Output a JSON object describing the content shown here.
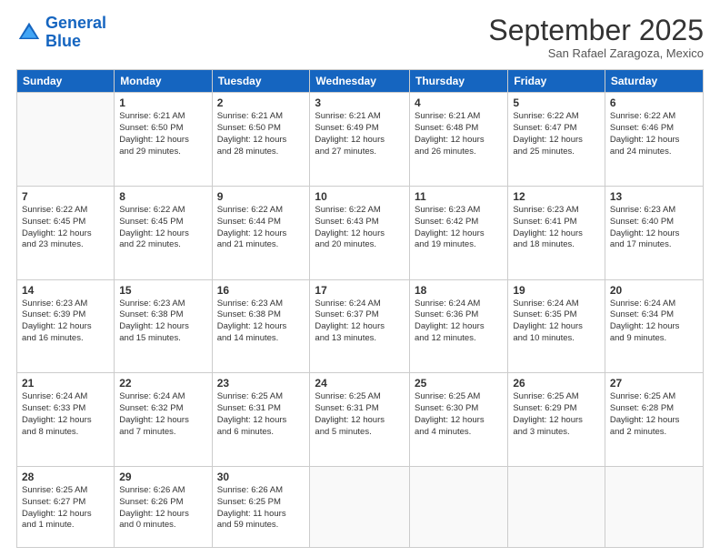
{
  "header": {
    "logo_line1": "General",
    "logo_line2": "Blue",
    "month": "September 2025",
    "location": "San Rafael Zaragoza, Mexico"
  },
  "days_of_week": [
    "Sunday",
    "Monday",
    "Tuesday",
    "Wednesday",
    "Thursday",
    "Friday",
    "Saturday"
  ],
  "weeks": [
    [
      {
        "num": "",
        "info": ""
      },
      {
        "num": "1",
        "info": "Sunrise: 6:21 AM\nSunset: 6:50 PM\nDaylight: 12 hours\nand 29 minutes."
      },
      {
        "num": "2",
        "info": "Sunrise: 6:21 AM\nSunset: 6:50 PM\nDaylight: 12 hours\nand 28 minutes."
      },
      {
        "num": "3",
        "info": "Sunrise: 6:21 AM\nSunset: 6:49 PM\nDaylight: 12 hours\nand 27 minutes."
      },
      {
        "num": "4",
        "info": "Sunrise: 6:21 AM\nSunset: 6:48 PM\nDaylight: 12 hours\nand 26 minutes."
      },
      {
        "num": "5",
        "info": "Sunrise: 6:22 AM\nSunset: 6:47 PM\nDaylight: 12 hours\nand 25 minutes."
      },
      {
        "num": "6",
        "info": "Sunrise: 6:22 AM\nSunset: 6:46 PM\nDaylight: 12 hours\nand 24 minutes."
      }
    ],
    [
      {
        "num": "7",
        "info": "Sunrise: 6:22 AM\nSunset: 6:45 PM\nDaylight: 12 hours\nand 23 minutes."
      },
      {
        "num": "8",
        "info": "Sunrise: 6:22 AM\nSunset: 6:45 PM\nDaylight: 12 hours\nand 22 minutes."
      },
      {
        "num": "9",
        "info": "Sunrise: 6:22 AM\nSunset: 6:44 PM\nDaylight: 12 hours\nand 21 minutes."
      },
      {
        "num": "10",
        "info": "Sunrise: 6:22 AM\nSunset: 6:43 PM\nDaylight: 12 hours\nand 20 minutes."
      },
      {
        "num": "11",
        "info": "Sunrise: 6:23 AM\nSunset: 6:42 PM\nDaylight: 12 hours\nand 19 minutes."
      },
      {
        "num": "12",
        "info": "Sunrise: 6:23 AM\nSunset: 6:41 PM\nDaylight: 12 hours\nand 18 minutes."
      },
      {
        "num": "13",
        "info": "Sunrise: 6:23 AM\nSunset: 6:40 PM\nDaylight: 12 hours\nand 17 minutes."
      }
    ],
    [
      {
        "num": "14",
        "info": "Sunrise: 6:23 AM\nSunset: 6:39 PM\nDaylight: 12 hours\nand 16 minutes."
      },
      {
        "num": "15",
        "info": "Sunrise: 6:23 AM\nSunset: 6:38 PM\nDaylight: 12 hours\nand 15 minutes."
      },
      {
        "num": "16",
        "info": "Sunrise: 6:23 AM\nSunset: 6:38 PM\nDaylight: 12 hours\nand 14 minutes."
      },
      {
        "num": "17",
        "info": "Sunrise: 6:24 AM\nSunset: 6:37 PM\nDaylight: 12 hours\nand 13 minutes."
      },
      {
        "num": "18",
        "info": "Sunrise: 6:24 AM\nSunset: 6:36 PM\nDaylight: 12 hours\nand 12 minutes."
      },
      {
        "num": "19",
        "info": "Sunrise: 6:24 AM\nSunset: 6:35 PM\nDaylight: 12 hours\nand 10 minutes."
      },
      {
        "num": "20",
        "info": "Sunrise: 6:24 AM\nSunset: 6:34 PM\nDaylight: 12 hours\nand 9 minutes."
      }
    ],
    [
      {
        "num": "21",
        "info": "Sunrise: 6:24 AM\nSunset: 6:33 PM\nDaylight: 12 hours\nand 8 minutes."
      },
      {
        "num": "22",
        "info": "Sunrise: 6:24 AM\nSunset: 6:32 PM\nDaylight: 12 hours\nand 7 minutes."
      },
      {
        "num": "23",
        "info": "Sunrise: 6:25 AM\nSunset: 6:31 PM\nDaylight: 12 hours\nand 6 minutes."
      },
      {
        "num": "24",
        "info": "Sunrise: 6:25 AM\nSunset: 6:31 PM\nDaylight: 12 hours\nand 5 minutes."
      },
      {
        "num": "25",
        "info": "Sunrise: 6:25 AM\nSunset: 6:30 PM\nDaylight: 12 hours\nand 4 minutes."
      },
      {
        "num": "26",
        "info": "Sunrise: 6:25 AM\nSunset: 6:29 PM\nDaylight: 12 hours\nand 3 minutes."
      },
      {
        "num": "27",
        "info": "Sunrise: 6:25 AM\nSunset: 6:28 PM\nDaylight: 12 hours\nand 2 minutes."
      }
    ],
    [
      {
        "num": "28",
        "info": "Sunrise: 6:25 AM\nSunset: 6:27 PM\nDaylight: 12 hours\nand 1 minute."
      },
      {
        "num": "29",
        "info": "Sunrise: 6:26 AM\nSunset: 6:26 PM\nDaylight: 12 hours\nand 0 minutes."
      },
      {
        "num": "30",
        "info": "Sunrise: 6:26 AM\nSunset: 6:25 PM\nDaylight: 11 hours\nand 59 minutes."
      },
      {
        "num": "",
        "info": ""
      },
      {
        "num": "",
        "info": ""
      },
      {
        "num": "",
        "info": ""
      },
      {
        "num": "",
        "info": ""
      }
    ]
  ]
}
